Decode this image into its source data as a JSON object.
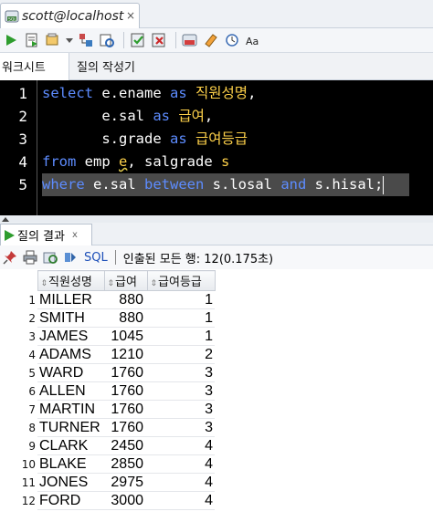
{
  "window": {
    "tab_title": "scott@localhost",
    "tab_close": "×",
    "tab_icon": "sql-connection-icon"
  },
  "toolbar": {
    "icons": [
      "run-statement-icon",
      "run-script-icon",
      "commit-icon",
      "dropdown-icon",
      "explain-plan-icon",
      "autotrace-icon",
      "commit-changes-icon",
      "rollback-icon",
      "sql-tuning-icon",
      "clear-icon",
      "history-icon",
      "format-icon"
    ]
  },
  "editor_tabs": [
    "워크시트",
    "질의 작성기"
  ],
  "editor": {
    "line_numbers": [
      "1",
      "2",
      "3",
      "4",
      "5"
    ],
    "lines": [
      [
        {
          "t": "select",
          "k": "kw"
        },
        {
          "t": " e.ename ",
          "k": ""
        },
        {
          "t": "as",
          "k": "kw"
        },
        {
          "t": " ",
          "k": ""
        },
        {
          "t": "직원성명",
          "k": "ko"
        },
        {
          "t": ",",
          "k": ""
        }
      ],
      [
        {
          "t": "       e.sal ",
          "k": ""
        },
        {
          "t": "as",
          "k": "kw"
        },
        {
          "t": " ",
          "k": ""
        },
        {
          "t": "급여",
          "k": "ko"
        },
        {
          "t": ",",
          "k": ""
        }
      ],
      [
        {
          "t": "       s.grade ",
          "k": ""
        },
        {
          "t": "as",
          "k": "kw"
        },
        {
          "t": " ",
          "k": ""
        },
        {
          "t": "급여등급",
          "k": "ko"
        }
      ],
      [
        {
          "t": "from",
          "k": "kw"
        },
        {
          "t": " emp ",
          "k": ""
        },
        {
          "t": "e",
          "k": "ko sq"
        },
        {
          "t": ", salgrade ",
          "k": ""
        },
        {
          "t": "s",
          "k": "ko"
        }
      ],
      [
        {
          "t": "where",
          "k": "kw"
        },
        {
          "t": " e.sal ",
          "k": ""
        },
        {
          "t": "between",
          "k": "kw"
        },
        {
          "t": " s.losal ",
          "k": ""
        },
        {
          "t": "and",
          "k": "kw"
        },
        {
          "t": " s.hisal;",
          "k": ""
        }
      ]
    ],
    "selected_line": 5
  },
  "result": {
    "tab_label": "질의 결과",
    "tab_close": "x",
    "sql_link": "SQL",
    "status": "인출된 모든 행: 12(0.175초)",
    "columns": [
      "직원성명",
      "급여",
      "급여등급"
    ],
    "rows": [
      [
        "1",
        "MILLER",
        "880",
        "1"
      ],
      [
        "2",
        "SMITH",
        "880",
        "1"
      ],
      [
        "3",
        "JAMES",
        "1045",
        "1"
      ],
      [
        "4",
        "ADAMS",
        "1210",
        "2"
      ],
      [
        "5",
        "WARD",
        "1760",
        "3"
      ],
      [
        "6",
        "ALLEN",
        "1760",
        "3"
      ],
      [
        "7",
        "MARTIN",
        "1760",
        "3"
      ],
      [
        "8",
        "TURNER",
        "1760",
        "3"
      ],
      [
        "9",
        "CLARK",
        "2450",
        "4"
      ],
      [
        "10",
        "BLAKE",
        "2850",
        "4"
      ],
      [
        "11",
        "JONES",
        "2975",
        "4"
      ],
      [
        "12",
        "FORD",
        "3000",
        "4"
      ]
    ]
  },
  "colors": {
    "keyword": "#5d8cff",
    "identifier": "#ffd24a",
    "editor_bg": "#000000",
    "link": "#1d4fb8"
  }
}
